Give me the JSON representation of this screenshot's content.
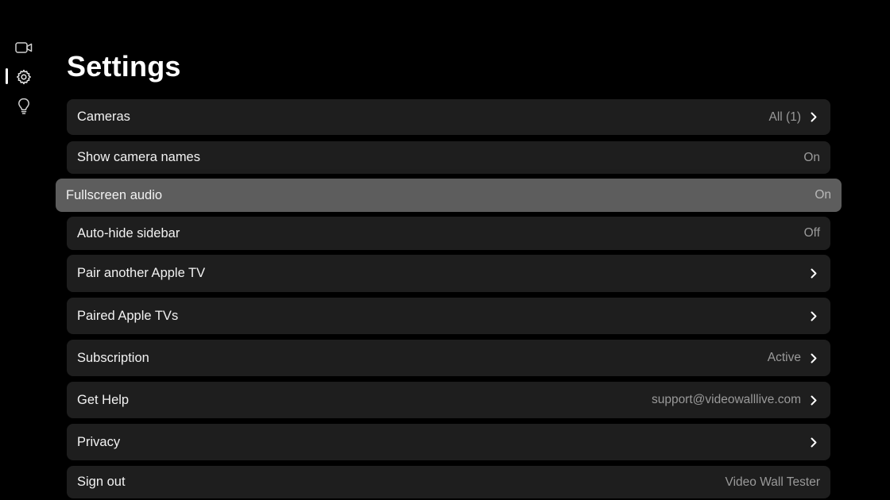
{
  "sidebar": {
    "items": [
      {
        "icon": "video-camera-icon",
        "active": false
      },
      {
        "icon": "gear-icon",
        "active": true
      },
      {
        "icon": "lightbulb-icon",
        "active": false
      }
    ]
  },
  "page": {
    "title": "Settings"
  },
  "settings": [
    {
      "label": "Cameras",
      "value": "All (1)",
      "chevron": true,
      "focused": false
    },
    {
      "label": "Show camera names",
      "value": "On",
      "chevron": false,
      "focused": false
    },
    {
      "label": "Fullscreen audio",
      "value": "On",
      "chevron": false,
      "focused": true
    },
    {
      "label": "Auto-hide sidebar",
      "value": "Off",
      "chevron": false,
      "focused": false
    },
    {
      "label": "Pair another Apple TV",
      "value": "",
      "chevron": true,
      "focused": false
    },
    {
      "label": "Paired Apple TVs",
      "value": "",
      "chevron": true,
      "focused": false
    },
    {
      "label": "Subscription",
      "value": "Active",
      "chevron": true,
      "focused": false
    },
    {
      "label": "Get Help",
      "value": "support@videowalllive.com",
      "chevron": true,
      "focused": false
    },
    {
      "label": "Privacy",
      "value": "",
      "chevron": true,
      "focused": false
    },
    {
      "label": "Sign out",
      "value": "Video Wall Tester",
      "chevron": false,
      "focused": false
    }
  ],
  "colors": {
    "background": "#000000",
    "row": "#1e1e1e",
    "row_focused": "#5d5d5d",
    "label": "#f2f2f2",
    "value": "#9a9a9a"
  }
}
